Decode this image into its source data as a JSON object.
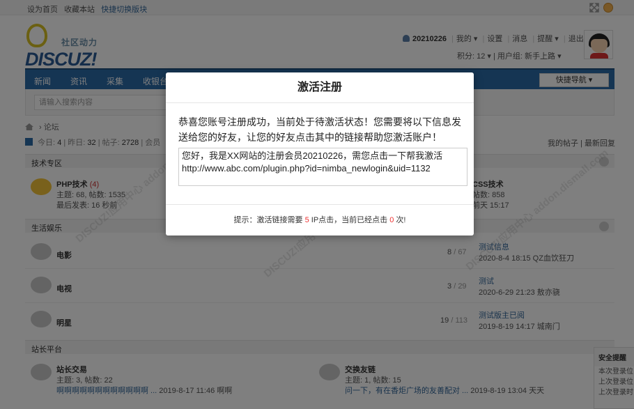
{
  "topbar": {
    "set_home": "设为首页",
    "bookmark": "收藏本站",
    "switch_style": "快捷切换版块"
  },
  "logo": {
    "slogan": "社区动力",
    "word": "DISCUZ!"
  },
  "user": {
    "username": "20210226",
    "menu": [
      "我的",
      "设置",
      "消息",
      "提醒",
      "退出"
    ],
    "points": "积分: 12",
    "group": "用户组: 新手上路"
  },
  "nav": {
    "items": [
      "新闻",
      "资讯",
      "采集",
      "收银台"
    ],
    "quick_nav": "快捷导航"
  },
  "search": {
    "placeholder": "请输入搜索内容"
  },
  "breadcrumb": {
    "home_label": "论坛"
  },
  "stats": {
    "today_label": "今日:",
    "today": "4",
    "yesterday_label": "昨日:",
    "yesterday": "32",
    "posts_label": "帖子:",
    "posts": "2728",
    "members_label": "会员"
  },
  "right_links": {
    "my_posts": "我的帖子",
    "latest": "最新回复"
  },
  "sections": [
    {
      "title": "技术专区"
    },
    {
      "title": "生活娱乐"
    },
    {
      "title": "站长平台"
    }
  ],
  "tech_forums": [
    {
      "name": "PHP技术",
      "count": "(4)",
      "meta": "主题: 68, 帖数: 1535",
      "last": "最后发表: 16 秒前"
    },
    {
      "name": "CSS技术",
      "meta": "帖数: 858",
      "last": "前天 15:17"
    }
  ],
  "life_forums": [
    {
      "name": "电影",
      "count_main": "8",
      "count_sub": "67",
      "last_title": "测试信息",
      "last_info": "2020-8-4 18:15 QZ血饮狂刀"
    },
    {
      "name": "电视",
      "count_main": "3",
      "count_sub": "29",
      "last_title": "测试",
      "last_info": "2020-6-29 21:23 敖亦骁"
    },
    {
      "name": "明星",
      "count_main": "19",
      "count_sub": "113",
      "last_title": "测试版主已阅",
      "last_info": "2019-8-19 14:17 城南门"
    }
  ],
  "webmaster_forums": [
    {
      "name": "站长交易",
      "meta": "主题: 3, 帖数: 22",
      "last_link": "啊啊啊啊啊啊啊啊啊啊啊啊 ...",
      "last_info": "2019-8-17 11:46 啊啊"
    },
    {
      "name": "交换友链",
      "meta": "主题: 1, 帖数: 15",
      "last_link": "问一下，有在香炬广场的友善配对 ...",
      "last_info": "2019-8-19 13:04 天天"
    }
  ],
  "safety": {
    "title": "安全提醒",
    "lines": [
      "本次登录位",
      "上次登录位",
      "上次登录时"
    ]
  },
  "dialog": {
    "title": "激活注册",
    "message": "恭喜您账号注册成功，当前处于待激活状态！您需要将以下信息发送给您的好友，让您的好友点击其中的链接帮助您激活账户！",
    "share_text": "您好，我是XX网站的注册会员20210226，需您点击一下帮我激活",
    "share_url": "http://www.abc.com/plugin.php?id=nimba_newlogin&uid=1132",
    "tip_prefix": "提示：激活链接需要",
    "tip_needed": "5",
    "tip_middle": "IP点击，当前已经点击",
    "tip_clicked": "0",
    "tip_suffix": "次!"
  },
  "watermark": "DISCUZ!应用中心 addon.dismall.com"
}
